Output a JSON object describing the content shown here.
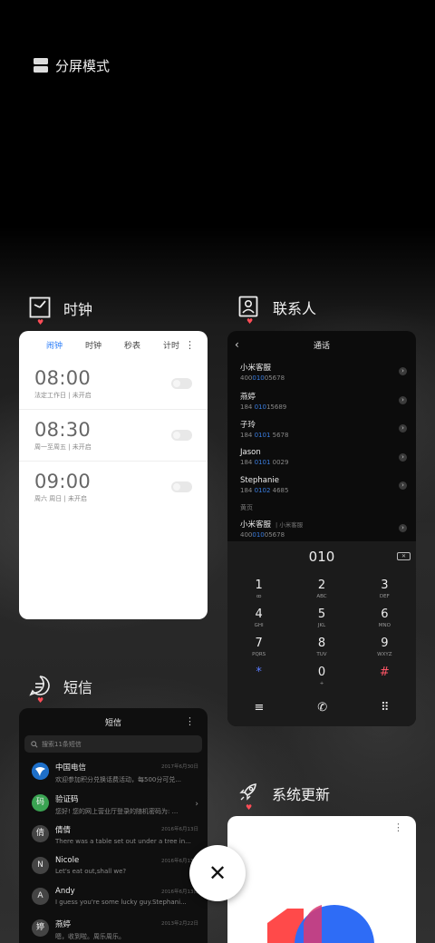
{
  "split_mode": {
    "label": "分屏模式"
  },
  "apps": {
    "clock": {
      "title": "时钟"
    },
    "contacts": {
      "title": "联系人"
    },
    "sms": {
      "title": "短信"
    },
    "update": {
      "title": "系统更新"
    }
  },
  "clock": {
    "tabs": [
      {
        "label": "闹钟",
        "active": true
      },
      {
        "label": "时钟",
        "active": false
      },
      {
        "label": "秒表",
        "active": false
      },
      {
        "label": "计时",
        "active": false
      }
    ],
    "more_icon": "⋮",
    "alarms": [
      {
        "time": "08:00",
        "desc": "法定工作日 | 未开启",
        "enabled": false
      },
      {
        "time": "08:30",
        "desc": "周一至周五 | 未开启",
        "enabled": false
      },
      {
        "time": "09:00",
        "desc": "周六 周日 | 未开启",
        "enabled": false
      }
    ]
  },
  "contacts": {
    "title": "通话",
    "back_icon": "‹",
    "list": [
      {
        "name": "小米客服",
        "pre": "400",
        "hl": "010",
        "post": "05678"
      },
      {
        "name": "燕婷",
        "pre": "184 ",
        "hl": "010",
        "post": "15689"
      },
      {
        "name": "子玲",
        "pre": "184 ",
        "hl": "0101",
        "post": " 5678"
      },
      {
        "name": "Jason",
        "pre": "184 ",
        "hl": "0101",
        "post": " 0029"
      },
      {
        "name": "Stephanie",
        "pre": "184 ",
        "hl": "0102",
        "post": " 4685"
      }
    ],
    "section": "黄页",
    "yellow": {
      "name": "小米客服",
      "tag": "| 小米客服",
      "pre": "400",
      "hl": "010",
      "post": "05678"
    },
    "dial_input": "010",
    "delete_icon": "✕",
    "keys": [
      {
        "digit": "1",
        "letters": "ꝏ"
      },
      {
        "digit": "2",
        "letters": "ABC"
      },
      {
        "digit": "3",
        "letters": "DEF"
      },
      {
        "digit": "4",
        "letters": "GHI"
      },
      {
        "digit": "5",
        "letters": "JKL"
      },
      {
        "digit": "6",
        "letters": "MNO"
      },
      {
        "digit": "7",
        "letters": "PQRS"
      },
      {
        "digit": "8",
        "letters": "TUV"
      },
      {
        "digit": "9",
        "letters": "WXYZ"
      },
      {
        "digit": "*",
        "letters": ""
      },
      {
        "digit": "0",
        "letters": "+"
      },
      {
        "digit": "#",
        "letters": ""
      }
    ],
    "actions": {
      "menu": "≡",
      "call": "✆",
      "grid": "⠿"
    }
  },
  "sms": {
    "title": "短信",
    "more_icon": "⋮",
    "search_placeholder": "搜索11条短信",
    "items": [
      {
        "avatar": "",
        "name": "中国电信",
        "text": "欢迎参加积分兑换话费活动，每500分可兑...",
        "date": "2017年6月30日"
      },
      {
        "avatar": "码",
        "name": "验证码",
        "text": "您好! 您的网上营业厅登录的随机密码为: ...",
        "date": ""
      },
      {
        "avatar": "倩",
        "name": "倩倩",
        "text": "There was a table set out under a tree in...",
        "date": "2016年6月13日"
      },
      {
        "avatar": "N",
        "name": "Nicole",
        "text": "Let's eat out,shall we?",
        "date": "2016年6月13日"
      },
      {
        "avatar": "A",
        "name": "Andy",
        "text": "I guess you're some lucky guy.Stephani...",
        "date": "2016年6月13日"
      },
      {
        "avatar": "婷",
        "name": "燕婷",
        "text": "嗯，收到啦。周乐周乐。",
        "date": "2013年2月22日"
      }
    ]
  },
  "update": {
    "more_icon": "⋮"
  },
  "close_icon": "✕",
  "colors": {
    "accent": "#2c7ef8",
    "heart": "#ff4d57",
    "miui_red": "#ff4a4a",
    "miui_blue": "#2e6cf6"
  }
}
